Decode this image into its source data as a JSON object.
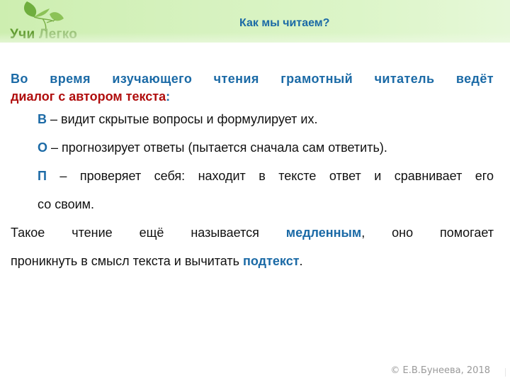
{
  "header": {
    "logo": {
      "word1": "Учи",
      "word2": "Легко",
      "icon": "leaves-icon"
    },
    "title": "Как мы читаем?"
  },
  "content": {
    "intro_line1": "Во время изучающего чтения грамотный читатель ведёт",
    "intro_line2_red": "диалог с автором текста",
    "intro_line2_colon": ":",
    "items": [
      {
        "letter": "В",
        "text": " – видит скрытые вопросы и формулирует их."
      },
      {
        "letter": "О",
        "text": " – прогнозирует ответы (пытается сначала сам ответить)."
      },
      {
        "letter": "П",
        "text": " – проверяет себя: находит в тексте ответ и сравнивает его",
        "continuation": "со своим."
      }
    ],
    "paragraph": {
      "line1_a": "Такое чтение ещё называется ",
      "line1_hl": "медленным",
      "line1_b": ", оно помогает",
      "line2_a": "проникнуть в смысл текста и вычитать ",
      "line2_hl": "подтекст",
      "line2_b": "."
    }
  },
  "footer": {
    "copyright": "© Е.В.Бунеева, 2018"
  },
  "colors": {
    "accent_blue": "#1b6aa6",
    "accent_red": "#b00e0e",
    "header_green": "#d6f2bf",
    "logo_green": "#5f9a2e"
  }
}
